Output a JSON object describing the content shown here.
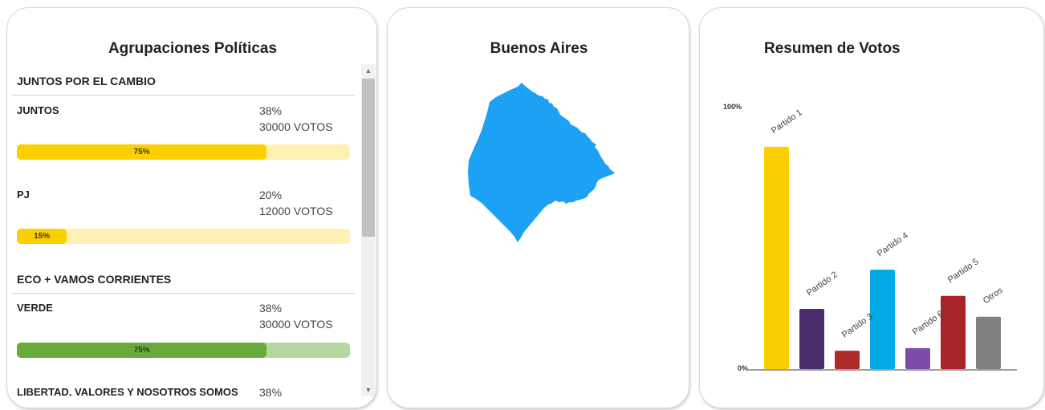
{
  "left_panel": {
    "title": "Agrupaciones Políticas",
    "groups": [
      {
        "name": "JUNTOS POR EL CAMBIO",
        "parties": [
          {
            "name": "JUNTOS",
            "percent": "38%",
            "votes": "30000 VOTOS",
            "bar_label": "75%",
            "bar_fraction": 0.75,
            "bar_color": "#fcd000",
            "track_color": "#fff0b3"
          },
          {
            "name": "PJ",
            "percent": "20%",
            "votes": "12000 VOTOS",
            "bar_label": "15%",
            "bar_fraction": 0.15,
            "bar_color": "#fcd000",
            "track_color": "#fff0b3"
          }
        ]
      },
      {
        "name": "ECO + VAMOS CORRIENTES",
        "parties": [
          {
            "name": "VERDE",
            "percent": "38%",
            "votes": "30000 VOTOS",
            "bar_label": "75%",
            "bar_fraction": 0.75,
            "bar_color": "#68ab3a",
            "track_color": "#b6d8a0"
          },
          {
            "name": "LIBERTAD, VALORES Y NOSOTROS SOMOS",
            "percent": "38%"
          }
        ]
      }
    ]
  },
  "middle_panel": {
    "title": "Buenos Aires",
    "map_color": "#1da1f5"
  },
  "right_panel": {
    "title": "Resumen de Votos",
    "chart_data": {
      "type": "bar",
      "title": "Resumen de Votos",
      "categories": [
        "Partido 1",
        "Partido 2",
        "Partido 3",
        "Partido 4",
        "Partido 6",
        "Partido 5",
        "Otros"
      ],
      "values": [
        85,
        23,
        7,
        38,
        8,
        28,
        20
      ],
      "colors": [
        "#fcd000",
        "#4b2d6e",
        "#b02a2a",
        "#03a9e4",
        "#7a4ea8",
        "#a82428",
        "#808080"
      ],
      "ylim": [
        0,
        100
      ],
      "ytick_labels": [
        "0%",
        "100%"
      ],
      "grid": false,
      "legend": "none"
    }
  }
}
